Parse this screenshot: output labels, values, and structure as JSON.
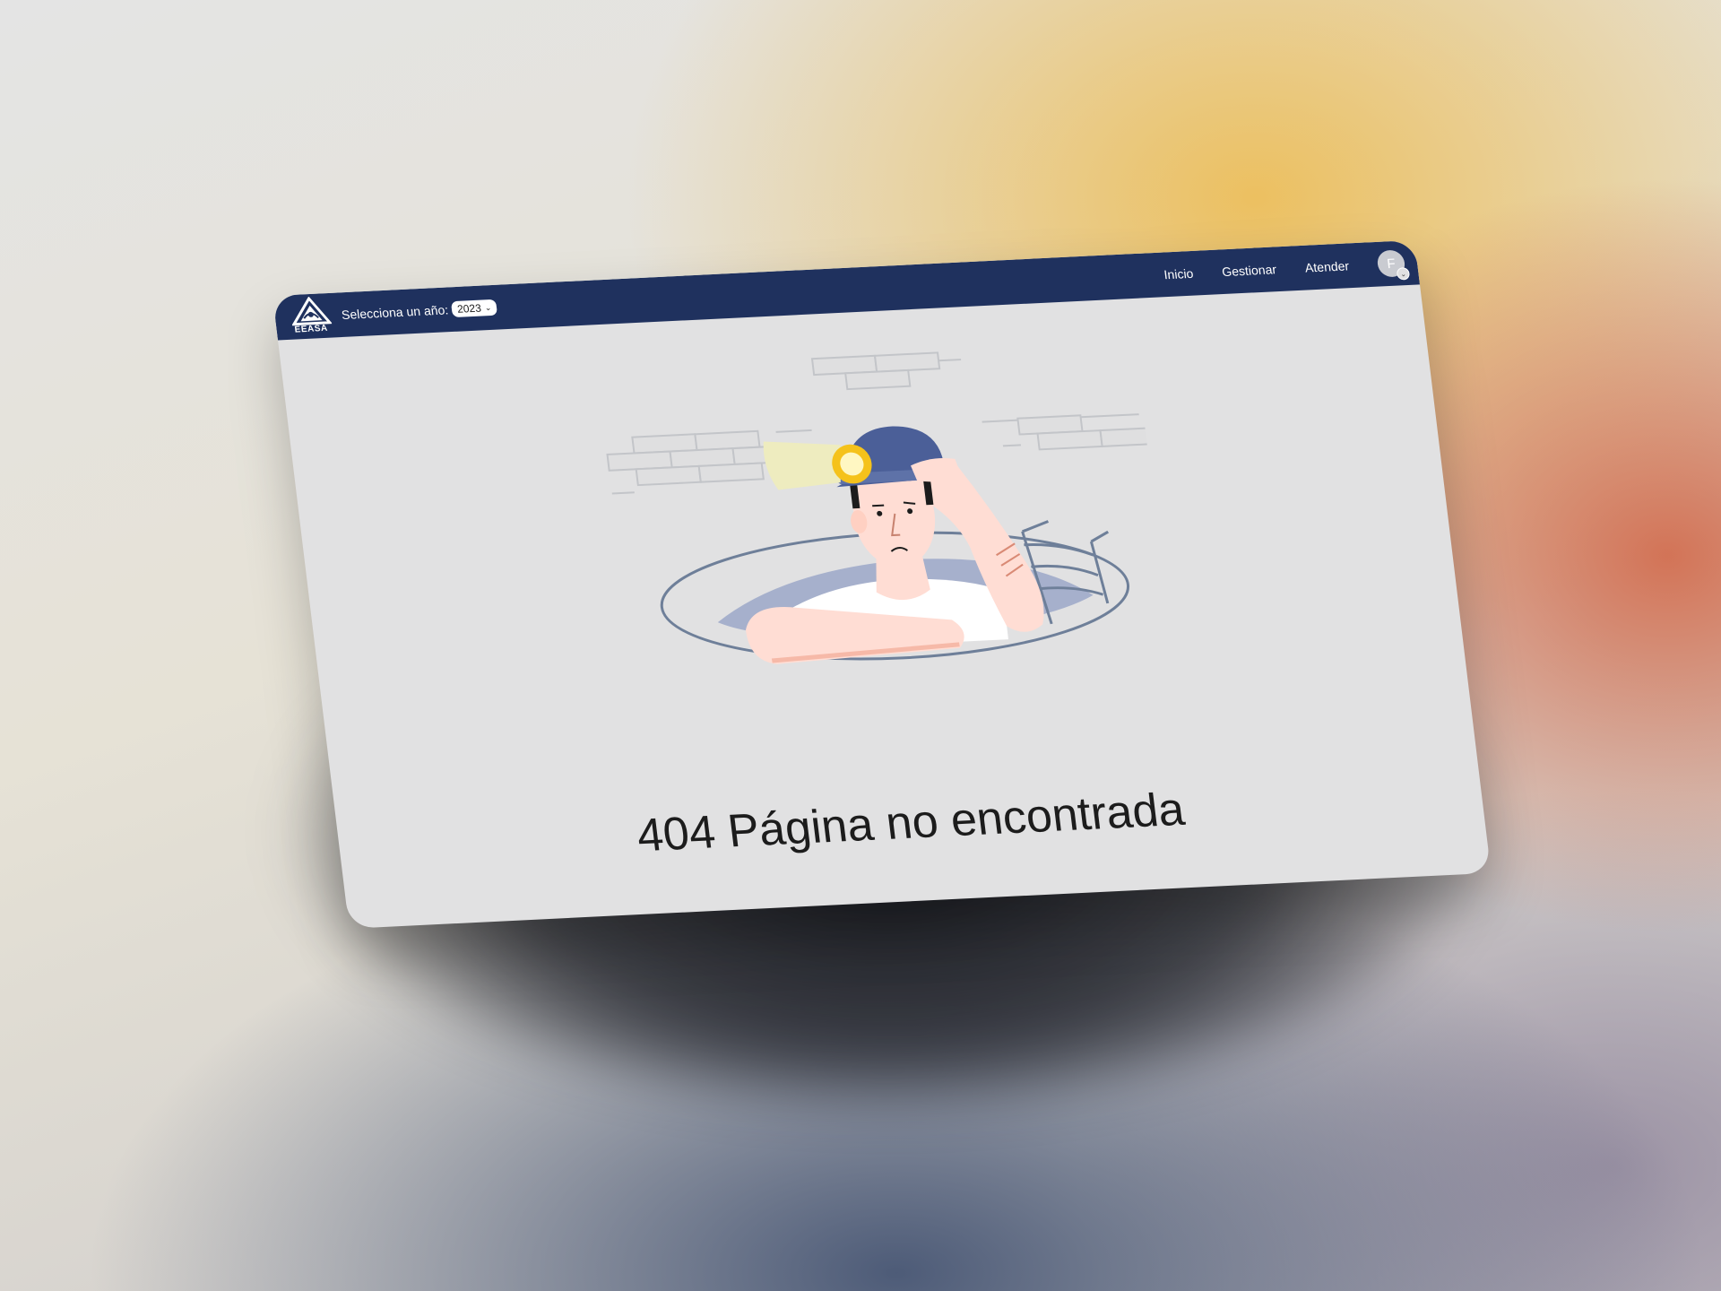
{
  "navbar": {
    "logo_text": "EEASA",
    "year_label": "Selecciona un año:",
    "year_value": "2023",
    "links": [
      "Inicio",
      "Gestionar",
      "Atender"
    ],
    "avatar_initial": "F"
  },
  "main": {
    "error_title": "404 Página no encontrada"
  },
  "icons": [
    "eeasa-logo-icon",
    "chevron-down-icon",
    "user-badge-icon",
    "miner-404-illustration"
  ],
  "colors": {
    "navbar": "#1f315e",
    "page_background": "#e1e1e2",
    "helmet": "#4b5f98",
    "lamp": "#f5c21b",
    "skin": "#ffddd4"
  }
}
